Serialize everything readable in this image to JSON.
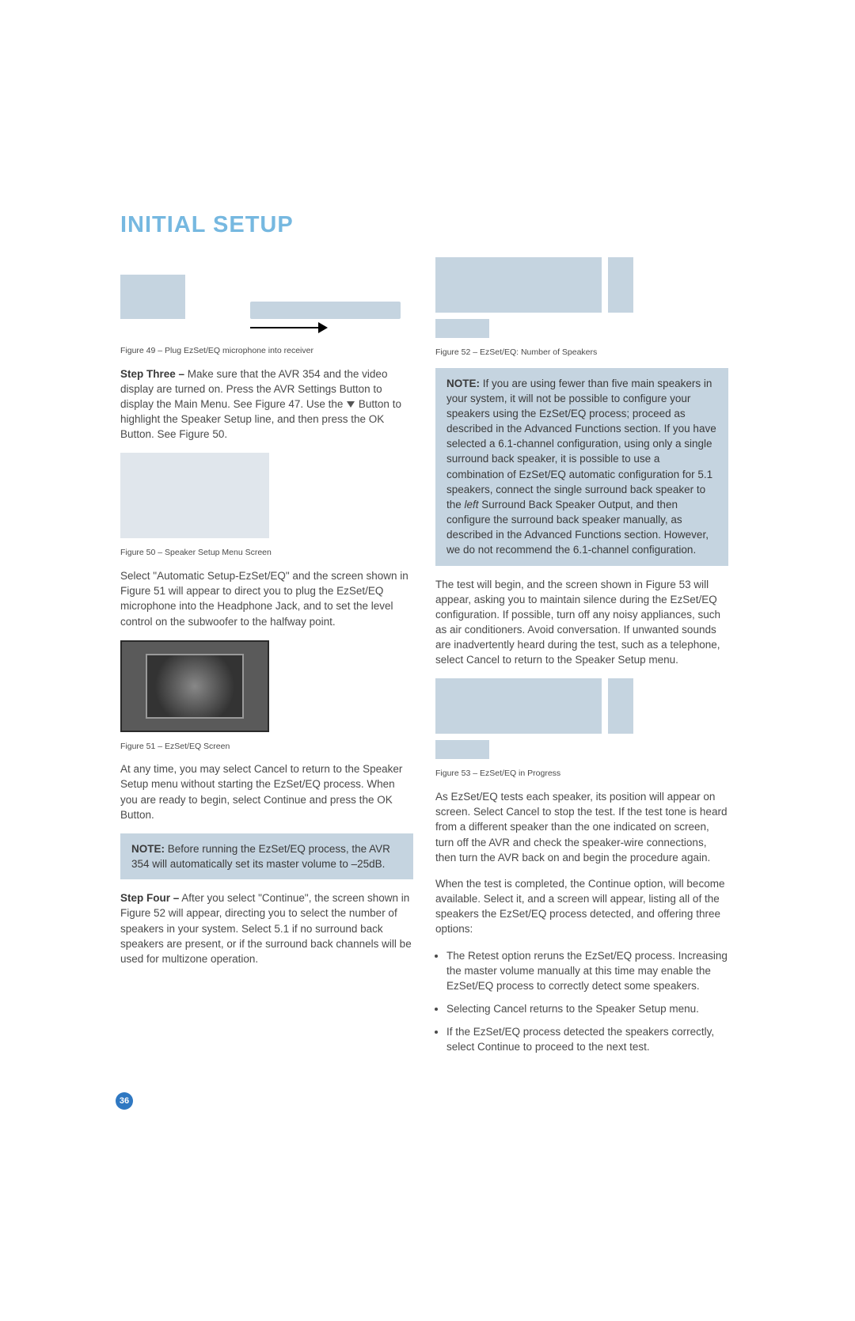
{
  "title": "INITIAL SETUP",
  "page_number": "36",
  "left": {
    "fig49_caption": "Figure 49 – Plug EzSet/EQ microphone into receiver",
    "step3_label": "Step Three –",
    "step3_body": " Make sure that the AVR 354 and the video display are turned on. Press the AVR Settings Button to display the Main Menu. See Figure 47. Use the ",
    "step3_body2": " Button to highlight the Speaker Setup line, and then press the OK Button. See Figure 50.",
    "fig50_caption": "Figure 50 – Speaker Setup Menu Screen",
    "select_auto": "Select \"Automatic Setup-EzSet/EQ\" and the screen shown in Figure 51 will appear to direct you to plug the EzSet/EQ microphone into the Headphone Jack, and to set the level control on the subwoofer to the halfway point.",
    "fig51_caption": "Figure 51 – EzSet/EQ Screen",
    "anytime": "At any time, you may select Cancel to return to the Speaker Setup menu without starting the EzSet/EQ process. When you are ready to begin, select Continue and press the OK Button.",
    "note1_label": "NOTE:",
    "note1_body": " Before running the EzSet/EQ process, the AVR 354 will automatically set its master volume to –25dB.",
    "step4_label": "Step Four –",
    "step4_body": " After you select \"Continue\", the screen shown in Figure 52 will appear, directing you to select the number of speakers in your system. Select 5.1 if no surround back speakers are present, or if the surround back channels will be used for multizone operation."
  },
  "right": {
    "fig52_caption": "Figure 52 – EzSet/EQ: Number of Speakers",
    "note2_label": "NOTE:",
    "note2_body": " If you are using fewer than five main speakers in your system, it will not be possible to configure your speakers using the EzSet/EQ process; proceed as described in the Advanced Functions section. If you have selected a 6.1-channel configuration, using only a single surround back speaker, it is possible to use a combination of EzSet/EQ automatic configuration for 5.1 speakers, connect the single surround back speaker to the ",
    "note2_italic": "left",
    "note2_body2": " Surround Back Speaker Output, and then configure the surround back speaker manually, as described in the Advanced Functions section. However, we do not recommend the 6.1-channel configuration.",
    "test_begin": "The test will begin, and the screen shown in Figure 53 will appear, asking you to maintain silence during the EzSet/EQ configuration. If possible, turn off any noisy appliances, such as air conditioners. Avoid conversation. If unwanted sounds are inadvertently heard during the test, such as a telephone, select Cancel to return to the Speaker Setup menu.",
    "fig53_caption": "Figure 53 – EzSet/EQ in Progress",
    "as_ezset": "As EzSet/EQ tests each speaker, its position will appear on screen. Select Cancel to stop the test. If the test tone is heard from a different speaker than the one indicated on screen, turn off the AVR and check the speaker-wire connections, then turn the AVR back on and begin the procedure again.",
    "when_complete": "When the test is completed, the Continue option, will become available. Select it, and a screen will appear, listing all of the speakers the EzSet/EQ process detected, and offering three options:",
    "bullet1": "The Retest option reruns the EzSet/EQ process. Increasing the master volume manually at this time may enable the EzSet/EQ process to correctly detect some speakers.",
    "bullet2": "Selecting Cancel returns to the Speaker Setup menu.",
    "bullet3": "If the EzSet/EQ process detected the speakers correctly, select Continue to proceed to the next test."
  }
}
